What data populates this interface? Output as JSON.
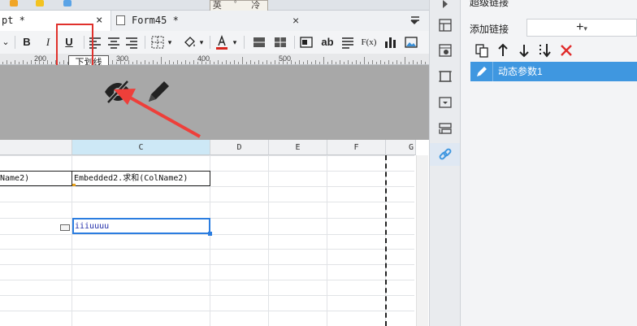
{
  "ime_hint": "英 ﾟ 冷",
  "tabs": [
    {
      "label": "pt *",
      "close": "×",
      "active": true
    },
    {
      "label": "Form45 *",
      "close": "×",
      "active": false
    }
  ],
  "toolbar": {
    "bold": "B",
    "italic": "I",
    "underline": "U",
    "text_ab": "ab",
    "formula": "F(x)",
    "dropdown_arrow": "▾",
    "font_color": "#d7261e"
  },
  "tooltip": "下划线",
  "ruler": {
    "labels": [
      "200",
      "300",
      "400",
      "500"
    ]
  },
  "grid": {
    "columns": [
      "C",
      "D",
      "E",
      "F",
      "G"
    ],
    "cells": {
      "b_row": "Name2)",
      "c_row": "Embedded2.求和(ColName2)",
      "c_active": "iiiuuuu"
    }
  },
  "panel": {
    "title": "超级链接",
    "add_label": "添加链接",
    "add_button": "+",
    "add_button_caret": "▾",
    "items": [
      {
        "label": "动态参数1",
        "selected": true
      }
    ]
  },
  "colors": {
    "accent": "#3f97e0",
    "highlight_box": "#e0312c",
    "column_header_selected": "#cde8f6"
  }
}
